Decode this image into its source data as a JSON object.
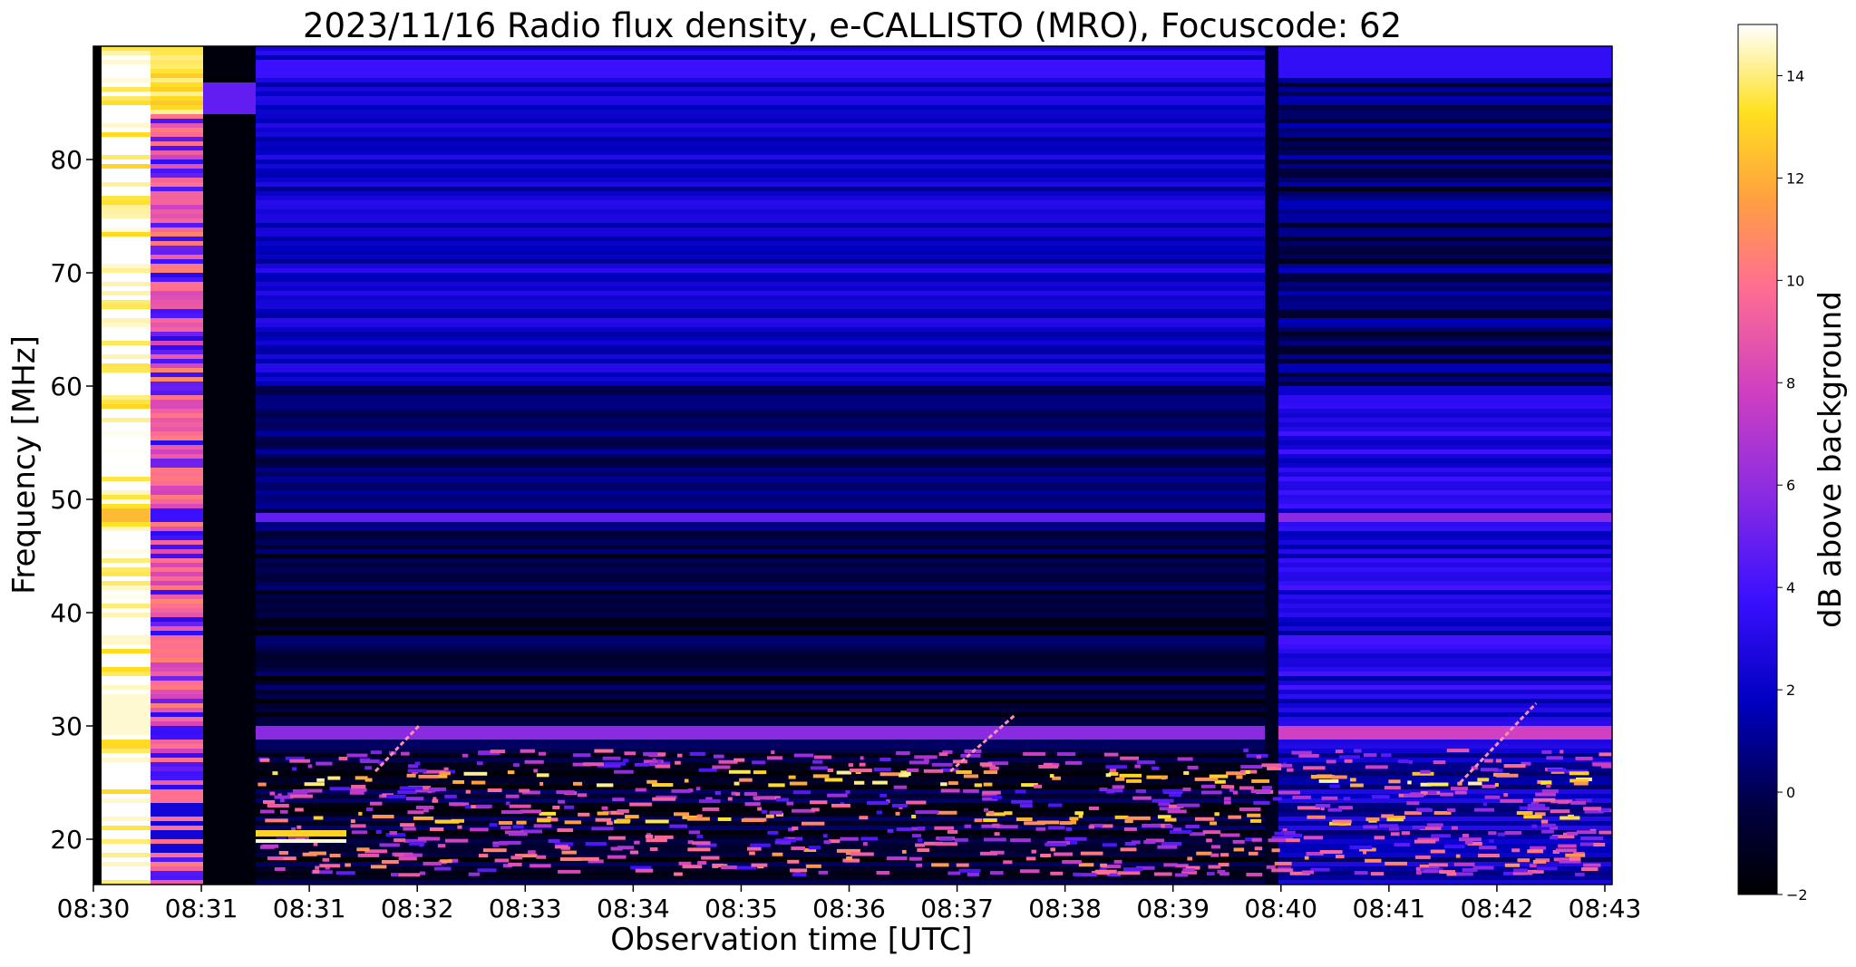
{
  "chart_data": {
    "type": "heatmap",
    "title": "2023/11/16  Radio flux density, e-CALLISTO (MRO), Focuscode: 62",
    "xlabel": "Observation time [UTC]",
    "ylabel": "Frequency [MHz]",
    "colorbar_label": "dB above background",
    "x_tick_labels": [
      "08:30",
      "08:31",
      "08:31",
      "08:32",
      "08:33",
      "08:34",
      "08:35",
      "08:36",
      "08:37",
      "08:38",
      "08:39",
      "08:40",
      "08:41",
      "08:42",
      "08:43"
    ],
    "y_ticks": [
      20,
      30,
      40,
      50,
      60,
      70,
      80
    ],
    "y_tick_labels": [
      "20",
      "30",
      "40",
      "50",
      "60",
      "70",
      "80"
    ],
    "ylim": [
      16,
      90
    ],
    "colorbar_ticks": [
      -2,
      0,
      2,
      4,
      6,
      8,
      10,
      12,
      14
    ],
    "colorbar_tick_labels": [
      "−2",
      "0",
      "2",
      "4",
      "6",
      "8",
      "10",
      "12",
      "14"
    ],
    "colorbar_range": [
      -2,
      15
    ],
    "colormap": "gnuplot2",
    "colors": {
      "background_low": "#000000",
      "low_blue": "#1010a0",
      "mid_purple": "#8a2be2",
      "pink": "#ff6fa0",
      "orange": "#ffa040",
      "yellow": "#ffff20",
      "high_white": "#ffffff"
    },
    "features": [
      {
        "name": "saturated-calibration-column",
        "time": "08:30",
        "level_db": 15
      },
      {
        "name": "calibration-column-2",
        "time": "08:30.5",
        "level_db": 7
      },
      {
        "name": "interference-band",
        "freq_mhz": 29.5,
        "level_db": 5
      },
      {
        "name": "interference-band",
        "freq_mhz": 25.5,
        "level_db": 11
      },
      {
        "name": "interference-band",
        "freq_mhz": 22,
        "level_db": 9
      },
      {
        "name": "interference-band",
        "freq_mhz": 48.5,
        "level_db": 4
      },
      {
        "name": "drifting-burst",
        "time_start": "08:32.6",
        "time_end": "08:33.0",
        "freq_start": 26,
        "freq_end": 30
      },
      {
        "name": "drifting-burst",
        "time_start": "08:37.9",
        "time_end": "08:38.5",
        "freq_start": 26,
        "freq_end": 31
      },
      {
        "name": "drifting-burst",
        "time_start": "08:42.6",
        "time_end": "08:43.3",
        "freq_start": 25,
        "freq_end": 32
      }
    ]
  }
}
